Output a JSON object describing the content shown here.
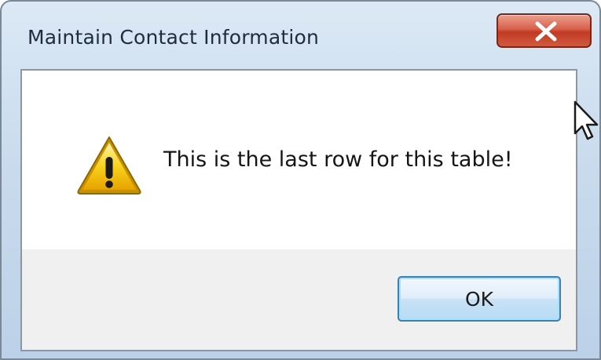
{
  "window": {
    "title": "Maintain Contact Information",
    "close_icon": "close-x-icon"
  },
  "dialog": {
    "icon": "warning-icon",
    "message": "This is the last row for this table!",
    "ok_label": "OK"
  },
  "colors": {
    "close_button": "#c8432c",
    "ok_border": "#3c7fb1",
    "warning_yellow": "#f5c400"
  }
}
